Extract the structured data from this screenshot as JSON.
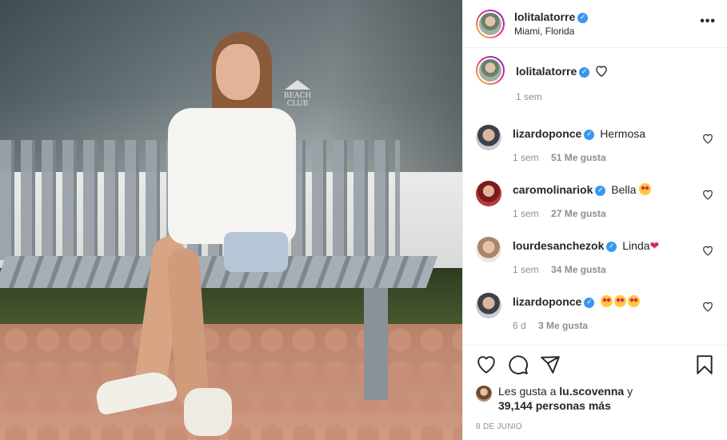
{
  "post": {
    "author": "lolitalatorre",
    "location": "Miami, Florida",
    "photo_sign": "BEACH CLUB",
    "caption_time": "1 sem",
    "more_icon": "ellipsis-icon",
    "verified_icon": "verified-badge-icon"
  },
  "comments": [
    {
      "user": "lizardoponce",
      "text": "Hermosa",
      "emojis": [],
      "time": "1 sem",
      "likes": "51 Me gusta"
    },
    {
      "user": "caromolinariok",
      "text": "Bella",
      "emojis": [
        "heart-eyes"
      ],
      "time": "1 sem",
      "likes": "27 Me gusta"
    },
    {
      "user": "lourdesanchezok",
      "text": "Linda",
      "emojis": [
        "red-heart"
      ],
      "time": "1 sem",
      "likes": "34 Me gusta"
    },
    {
      "user": "lizardoponce",
      "text": "",
      "emojis": [
        "heart-eyes",
        "heart-eyes",
        "heart-eyes"
      ],
      "time": "6 d",
      "likes": "3 Me gusta"
    }
  ],
  "actions": {
    "icons": [
      "heart-icon",
      "comment-icon",
      "share-icon",
      "bookmark-icon"
    ]
  },
  "likes": {
    "prefix": "Les gusta a",
    "user": "lu.scovenna",
    "connector": "y",
    "count_text": "39,144 personas más"
  },
  "date": "8 DE JUNIO",
  "colors": {
    "verified": "#3897f0",
    "muted": "#8e8e8e",
    "text": "#262626",
    "red": "#e0245e"
  }
}
